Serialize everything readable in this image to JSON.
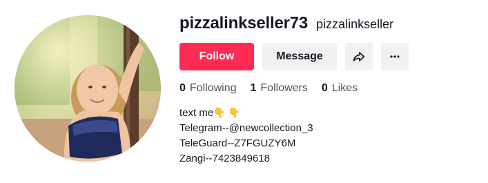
{
  "profile": {
    "username": "pizzalinkseller73",
    "nickname": "pizzalinkseller",
    "avatar_icon": "profile-photo"
  },
  "actions": {
    "follow_label": "Follow",
    "message_label": "Message",
    "share_icon": "share-arrow-icon",
    "more_icon": "more-dots-icon",
    "follow_color": "#fe2c55"
  },
  "stats": {
    "following_count": "0",
    "following_label": "Following",
    "followers_count": "1",
    "followers_label": "Followers",
    "likes_count": "0",
    "likes_label": "Likes"
  },
  "bio": {
    "line1": "text me",
    "line1_emoji": "👇 👇",
    "line2": "Telegram--@newcollection_3",
    "line3": "TeleGuard--Z7FGUZY6M",
    "line4": "Zangi--7423849618"
  }
}
